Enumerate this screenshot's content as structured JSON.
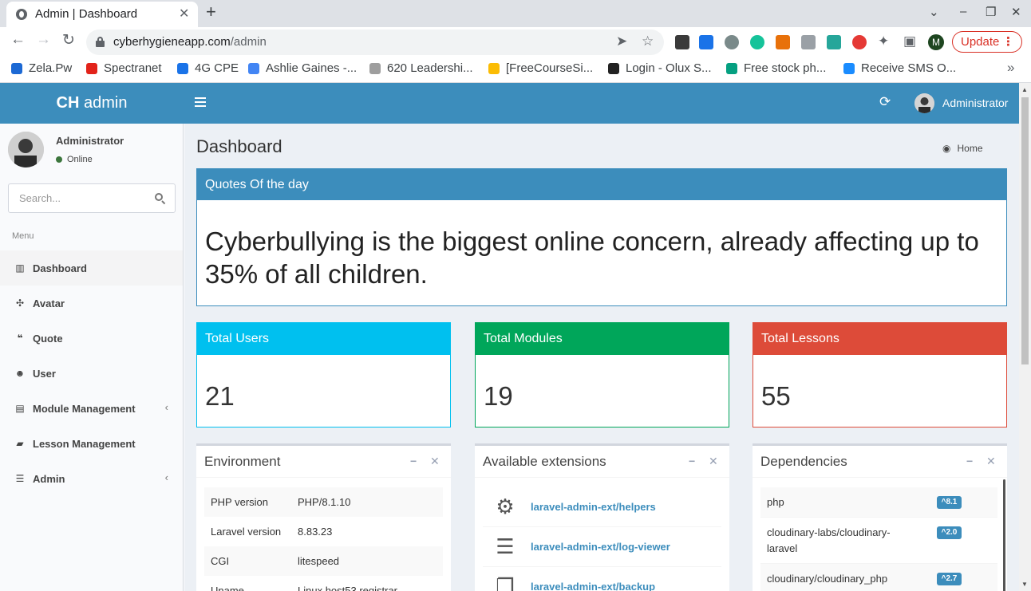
{
  "browser": {
    "tab_title": "Admin | Dashboard",
    "url_domain": "cyberhygieneapp.com",
    "url_path": "/admin",
    "profile_initial": "M",
    "update_label": "Update",
    "bookmarks": [
      {
        "label": "Zela.Pw",
        "icon_color": "#1c69d4"
      },
      {
        "label": "Spectranet",
        "icon_color": "#e2231a"
      },
      {
        "label": "4G CPE",
        "icon_color": "#1a73e8"
      },
      {
        "label": "Ashlie Gaines -...",
        "icon_color": "#4285f4"
      },
      {
        "label": "620 Leadershi...",
        "icon_color": "#9e9e9e"
      },
      {
        "label": "[FreeCourseSi...",
        "icon_color": "#fbbc04"
      },
      {
        "label": "Login - Olux S...",
        "icon_color": "#222222"
      },
      {
        "label": "Free stock ph...",
        "icon_color": "#05a081"
      },
      {
        "label": "Receive SMS O...",
        "icon_color": "#1a8cff"
      }
    ]
  },
  "header": {
    "logo_bold": "CH",
    "logo_rest": " admin",
    "user_name": "Administrator"
  },
  "sidebar": {
    "user_name": "Administrator",
    "status": "Online",
    "search_placeholder": "Search...",
    "menu_header": "Menu",
    "items": [
      {
        "label": "Dashboard",
        "icon": "bar-chart-icon",
        "glyph": "▥",
        "active": true,
        "chevron": false
      },
      {
        "label": "Avatar",
        "icon": "arrows-icon",
        "glyph": "✣",
        "active": false,
        "chevron": false
      },
      {
        "label": "Quote",
        "icon": "quote-icon",
        "glyph": "❝",
        "active": false,
        "chevron": false
      },
      {
        "label": "User",
        "icon": "users-icon",
        "glyph": "☻",
        "active": false,
        "chevron": false
      },
      {
        "label": "Module Management",
        "icon": "archive-icon",
        "glyph": "▤",
        "active": false,
        "chevron": true
      },
      {
        "label": "Lesson Management",
        "icon": "book-icon",
        "glyph": "▰",
        "active": false,
        "chevron": false
      },
      {
        "label": "Admin",
        "icon": "tasks-icon",
        "glyph": "☰",
        "active": false,
        "chevron": true
      }
    ],
    "chevron_glyph": "‹"
  },
  "content": {
    "page_title": "Dashboard",
    "breadcrumb": "Home",
    "quote": {
      "title": "Quotes Of the day",
      "text": "Cyberbullying is the biggest online concern, already affecting up to 35% of all children."
    },
    "stats": [
      {
        "title": "Total Users",
        "value": "21",
        "color": "#00c0ef"
      },
      {
        "title": "Total Modules",
        "value": "19",
        "color": "#00a65a"
      },
      {
        "title": "Total Lessons",
        "value": "55",
        "color": "#dd4b39"
      }
    ],
    "environment": {
      "title": "Environment",
      "rows": [
        {
          "key": "PHP version",
          "value": "PHP/8.1.10"
        },
        {
          "key": "Laravel version",
          "value": "8.83.23"
        },
        {
          "key": "CGI",
          "value": "litespeed"
        },
        {
          "key": "Uname",
          "value": "Linux host53.registrar"
        }
      ]
    },
    "extensions": {
      "title": "Available extensions",
      "items": [
        {
          "name": "laravel-admin-ext/helpers",
          "icon": "gears-icon",
          "glyph": "⚙"
        },
        {
          "name": "laravel-admin-ext/log-viewer",
          "icon": "database-icon",
          "glyph": "☰"
        },
        {
          "name": "laravel-admin-ext/backup",
          "icon": "copy-icon",
          "glyph": "❐"
        }
      ]
    },
    "dependencies": {
      "title": "Dependencies",
      "items": [
        {
          "name": "php",
          "version": "^8.1"
        },
        {
          "name": "cloudinary-labs/cloudinary-laravel",
          "version": "^2.0"
        },
        {
          "name": "cloudinary/cloudinary_php",
          "version": "^2.7"
        }
      ]
    }
  }
}
